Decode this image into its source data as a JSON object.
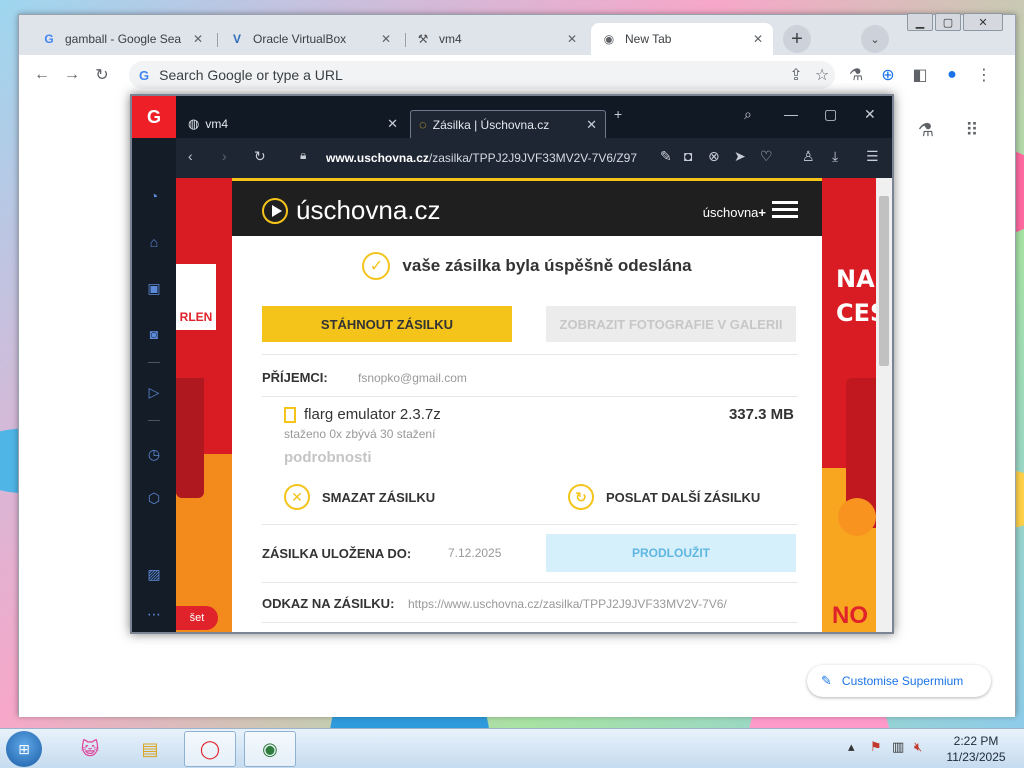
{
  "chrome": {
    "tabs": [
      {
        "label": "gamball - Google Sea",
        "icon": "google-icon"
      },
      {
        "label": "Oracle VirtualBox",
        "icon": "virtualbox-icon"
      },
      {
        "label": "vm4",
        "icon": "vm-icon"
      },
      {
        "label": "New Tab",
        "icon": "chrome-icon"
      }
    ],
    "new_tab_symbol": "+",
    "tab_search_symbol": "⌄",
    "window_controls": {
      "minimize": "▁",
      "maximize": "▢",
      "close": "✕"
    },
    "omnibox_placeholder": "Search Google or type a URL",
    "customise_label": "Customise Supermium"
  },
  "opera": {
    "tabs": [
      {
        "label": "vm4"
      },
      {
        "label": "Zásilka | Úschovna.cz"
      }
    ],
    "url_domain": "www.uschovna.cz",
    "url_path": "/zasilka/TPPJ2J9JVF33MV2V-7V6/Z97",
    "sidebar_button": "šet"
  },
  "uschovna": {
    "brand": "úschovna.cz",
    "plus_label": "úschovna",
    "success_message": "vaše zásilka byla úspěšně odeslána",
    "download_button": "STÁHNOUT ZÁSILKU",
    "gallery_button": "ZOBRAZIT FOTOGRAFIE V GALERII",
    "recipients_label": "PŘÍJEMCI:",
    "recipients_value": "fsnopko@gmail.com",
    "file_name": "flarg emulator 2.3.7z",
    "file_size": "337.3 MB",
    "file_meta": "staženo 0x zbývá 30 stažení",
    "details_label": "podrobnosti",
    "delete_label": "SMAZAT ZÁSILKU",
    "send_another_label": "POSLAT DALŠÍ ZÁSILKU",
    "stored_until_label": "ZÁSILKA ULOŽENA DO:",
    "stored_until_value": "7.12.2025",
    "extend_button": "PRODLOUŽIT",
    "link_label": "ODKAZ NA ZÁSILKU:",
    "link_value": "https://www.uschovna.cz/zasilka/TPPJ2J9JVF33MV2V-7V6/"
  },
  "ads": {
    "left_brand": "RLEN",
    "right_headline": "NA CES",
    "right_bottom": "NO"
  },
  "taskbar": {
    "time": "2:22 PM",
    "date": "11/23/2025"
  },
  "colors": {
    "uschovna_yellow": "#f4c41b",
    "opera_red": "#ee1f27",
    "chrome_blue": "#1a73e8"
  }
}
